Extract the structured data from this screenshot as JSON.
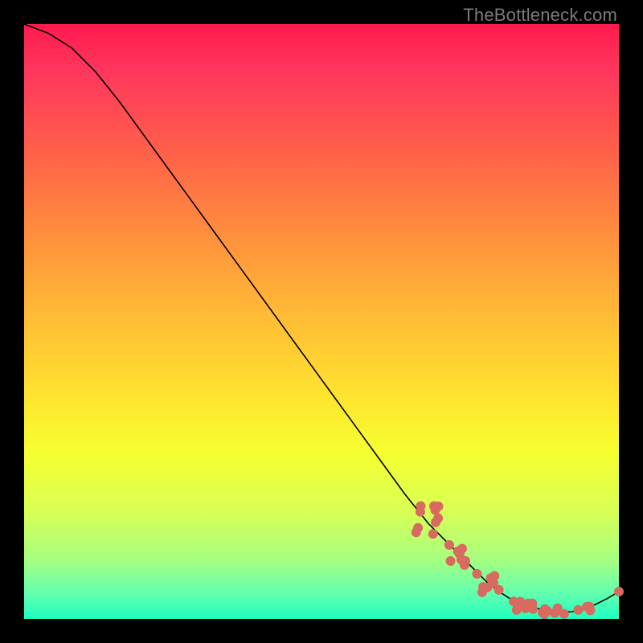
{
  "watermark": "TheBottleneck.com",
  "colors": {
    "dot": "#d86a5f",
    "line": "#000000"
  },
  "chart_data": {
    "type": "line",
    "title": "",
    "xlabel": "",
    "ylabel": "",
    "xlim": [
      0,
      100
    ],
    "ylim": [
      0,
      100
    ],
    "grid": false,
    "legend": false,
    "series": [
      {
        "name": "curve",
        "x": [
          0,
          4,
          8,
          12,
          16,
          20,
          24,
          28,
          32,
          36,
          40,
          44,
          48,
          52,
          56,
          60,
          64,
          68,
          72,
          74,
          76,
          78,
          80,
          82,
          84,
          86,
          88,
          90,
          92,
          94,
          96,
          98,
          100
        ],
        "y": [
          100,
          98.5,
          96,
          92,
          87,
          81.5,
          76,
          70.5,
          65,
          59.5,
          54,
          48.5,
          43,
          37.5,
          32,
          26.5,
          21,
          16,
          12,
          10,
          8,
          6,
          4.5,
          3.2,
          2.4,
          1.8,
          1.4,
          1.2,
          1.2,
          1.6,
          2.4,
          3.4,
          4.6
        ]
      }
    ],
    "scatter_clusters": [
      {
        "cx": 68,
        "cy": 16.5,
        "n": 10,
        "spread_x": 2.2,
        "spread_y": 2.6
      },
      {
        "cx": 73,
        "cy": 11.0,
        "n": 8,
        "spread_x": 2.0,
        "spread_y": 2.2
      },
      {
        "cx": 78,
        "cy": 6.2,
        "n": 8,
        "spread_x": 2.0,
        "spread_y": 1.8
      },
      {
        "cx": 84,
        "cy": 2.2,
        "n": 9,
        "spread_x": 2.4,
        "spread_y": 0.9
      },
      {
        "cx": 89,
        "cy": 1.3,
        "n": 7,
        "spread_x": 2.4,
        "spread_y": 0.6
      },
      {
        "cx": 94,
        "cy": 1.6,
        "n": 4,
        "spread_x": 1.6,
        "spread_y": 0.5
      },
      {
        "cx": 100,
        "cy": 4.6,
        "n": 1,
        "spread_x": 0.0,
        "spread_y": 0.0
      }
    ],
    "dot_radius_px": 5.5
  }
}
